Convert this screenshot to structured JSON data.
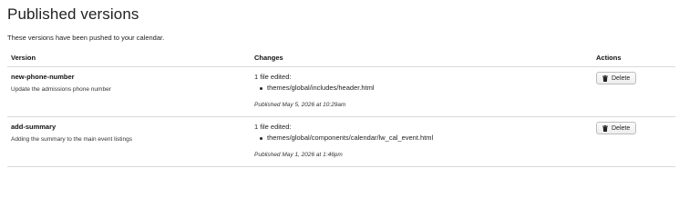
{
  "page": {
    "title": "Published versions",
    "subtitle": "These versions have been pushed to your calendar."
  },
  "table": {
    "headers": {
      "version": "Version",
      "changes": "Changes",
      "actions": "Actions"
    },
    "rows": [
      {
        "name": "new-phone-number",
        "description": "Update the admissions phone number",
        "changes_summary": "1 file edited:",
        "files": [
          "themes/global/includes/header.html"
        ],
        "published": "Published May 5, 2026 at 10:29am",
        "action_label": "Delete",
        "action_icon": "trash-icon"
      },
      {
        "name": "add-summary",
        "description": "Adding the summary to the main event listings",
        "changes_summary": "1 file edited:",
        "files": [
          "themes/global/components/calendar/lw_cal_event.html"
        ],
        "published": "Published May 1, 2026 at 1:46pm",
        "action_label": "Delete",
        "action_icon": "trash-icon"
      }
    ]
  },
  "colors": {
    "text": "#222222",
    "border": "#d9d9d9",
    "button_border": "#bdbdbd",
    "button_bg": "#f4f4f4"
  }
}
